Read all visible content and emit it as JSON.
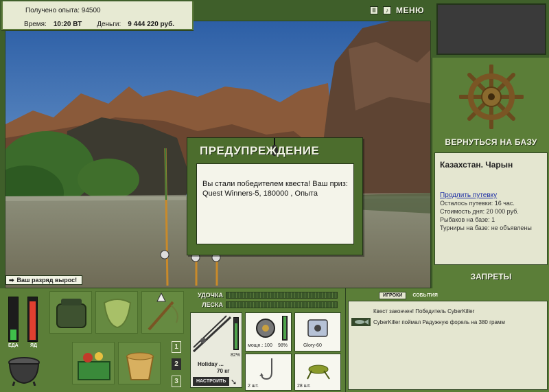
{
  "info": {
    "experience_label": "Получено опыта:",
    "experience_value": "94500",
    "time_label": "Время:",
    "time_value": "10:20 ВТ",
    "money_label": "Деньги:",
    "money_value": "9 444 220 руб."
  },
  "top": {
    "pause_icon": "pause-icon",
    "sound_icon": "sound-icon",
    "menu_label": "МЕНЮ"
  },
  "right_panel": {
    "return_label": "ВЕРНУТЬСЯ НА БАЗУ",
    "location_title": "Казахстан. Чарын",
    "extend_link": "Продлить путевку",
    "lines": [
      "Осталось путевки: 16 час.",
      "Стоимость дня: 20 000 руб.",
      "Рыбаков на базе: 1",
      "Турниры на базе: не объявлены"
    ],
    "bans_label": "ЗАПРЕТЫ"
  },
  "dialog": {
    "title": "ПРЕДУПРЕЖДЕНИЕ",
    "message": "Вы стали победителем квеста! Ваш приз: Quest Winners-5, 180000 , Опыта"
  },
  "toast": {
    "text": "Ваш разряд вырос!"
  },
  "meters": {
    "food_label": "ЕДА",
    "poison_label": "ЯД",
    "food_level": 0.25,
    "poison_level": 0.9
  },
  "inventory_pages": [
    "1",
    "2",
    "3"
  ],
  "inventory_active_page": "2",
  "tackle": {
    "rod_label": "УДОЧКА",
    "line_label": "ЛЕСКА",
    "rod_name": "Holiday ...",
    "rod_load": "70 кг",
    "rod_percent": "82%",
    "reel_caption": "мощн.: 100",
    "reel_percent": "98%",
    "bait_box_caption": "Glory-60",
    "hook_caption": "2 шт.",
    "bait_caption": "28 шт.",
    "setup_label": "НАСТРОИТЬ"
  },
  "log": {
    "tab_players": "ИГРОКИ",
    "tab_events": "СОБЫТИЯ",
    "line1": "Квест закончен! Победитель CyberKiller",
    "line2": "CyberKiller поймал Радужную форель на 380 грамм"
  },
  "colors": {
    "panel_green": "#5b7e38",
    "accent_light": "#e7ead3",
    "link_blue": "#1d2fa5"
  }
}
